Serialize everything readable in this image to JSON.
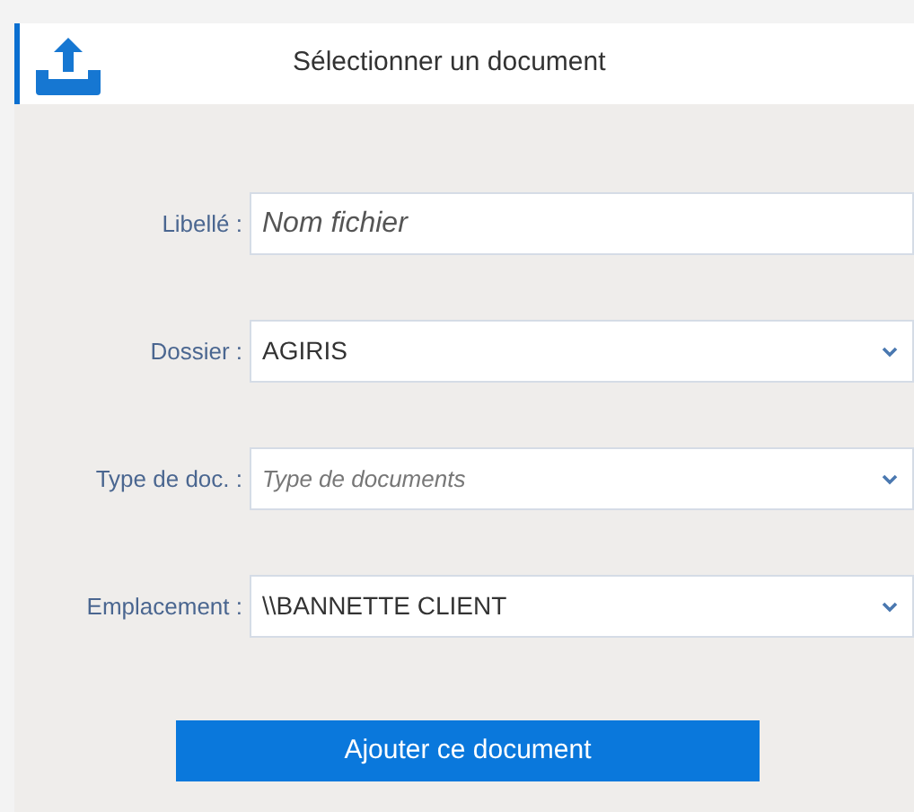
{
  "dialog": {
    "title": "Sélectionner un document"
  },
  "fields": [
    {
      "kind": "text",
      "label": "Libellé :",
      "placeholder": "Nom fichier"
    },
    {
      "kind": "select",
      "label": "Dossier :",
      "value": "AGIRIS"
    },
    {
      "kind": "select",
      "label": "Type de doc. :",
      "placeholder": "Type de documents"
    },
    {
      "kind": "select",
      "label": "Emplacement :",
      "value": "\\\\BANNETTE CLIENT"
    }
  ],
  "submit_button": "Ajouter ce document"
}
